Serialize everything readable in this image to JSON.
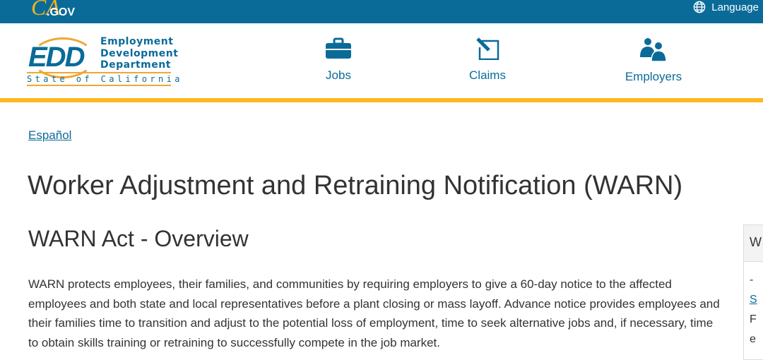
{
  "topbar": {
    "logo_ca": "CA",
    "logo_gov": ".GOV",
    "language_label": "Language"
  },
  "logo": {
    "abbr": "EDD",
    "line1": "Employment",
    "line2": "Development",
    "line3": "Department",
    "state": "State of California"
  },
  "nav": [
    {
      "label": "Jobs",
      "icon": "briefcase-icon"
    },
    {
      "label": "Claims",
      "icon": "pen-document-icon"
    },
    {
      "label": "Employers",
      "icon": "people-icon"
    }
  ],
  "colors": {
    "brand_blue": "#0a6b99",
    "accent_gold": "#fdb81e"
  },
  "language_link": "Español",
  "page_title": "Worker Adjustment and Retraining Notification (WARN)",
  "section_title": "WARN Act - Overview",
  "paragraph": "WARN protects employees, their families, and communities by requiring employers to give a 60-day notice to the affected employees and both state and local representatives before a plant closing or mass layoff. Advance notice provides employees and their families time to transition and adjust to the potential loss of employment, time to seek alternative jobs and, if necessary, time to obtain skills training or retraining to successfully compete in the job market.",
  "side_panel": {
    "heading": "W",
    "lines": [
      "-",
      "S",
      "F",
      "e"
    ]
  }
}
